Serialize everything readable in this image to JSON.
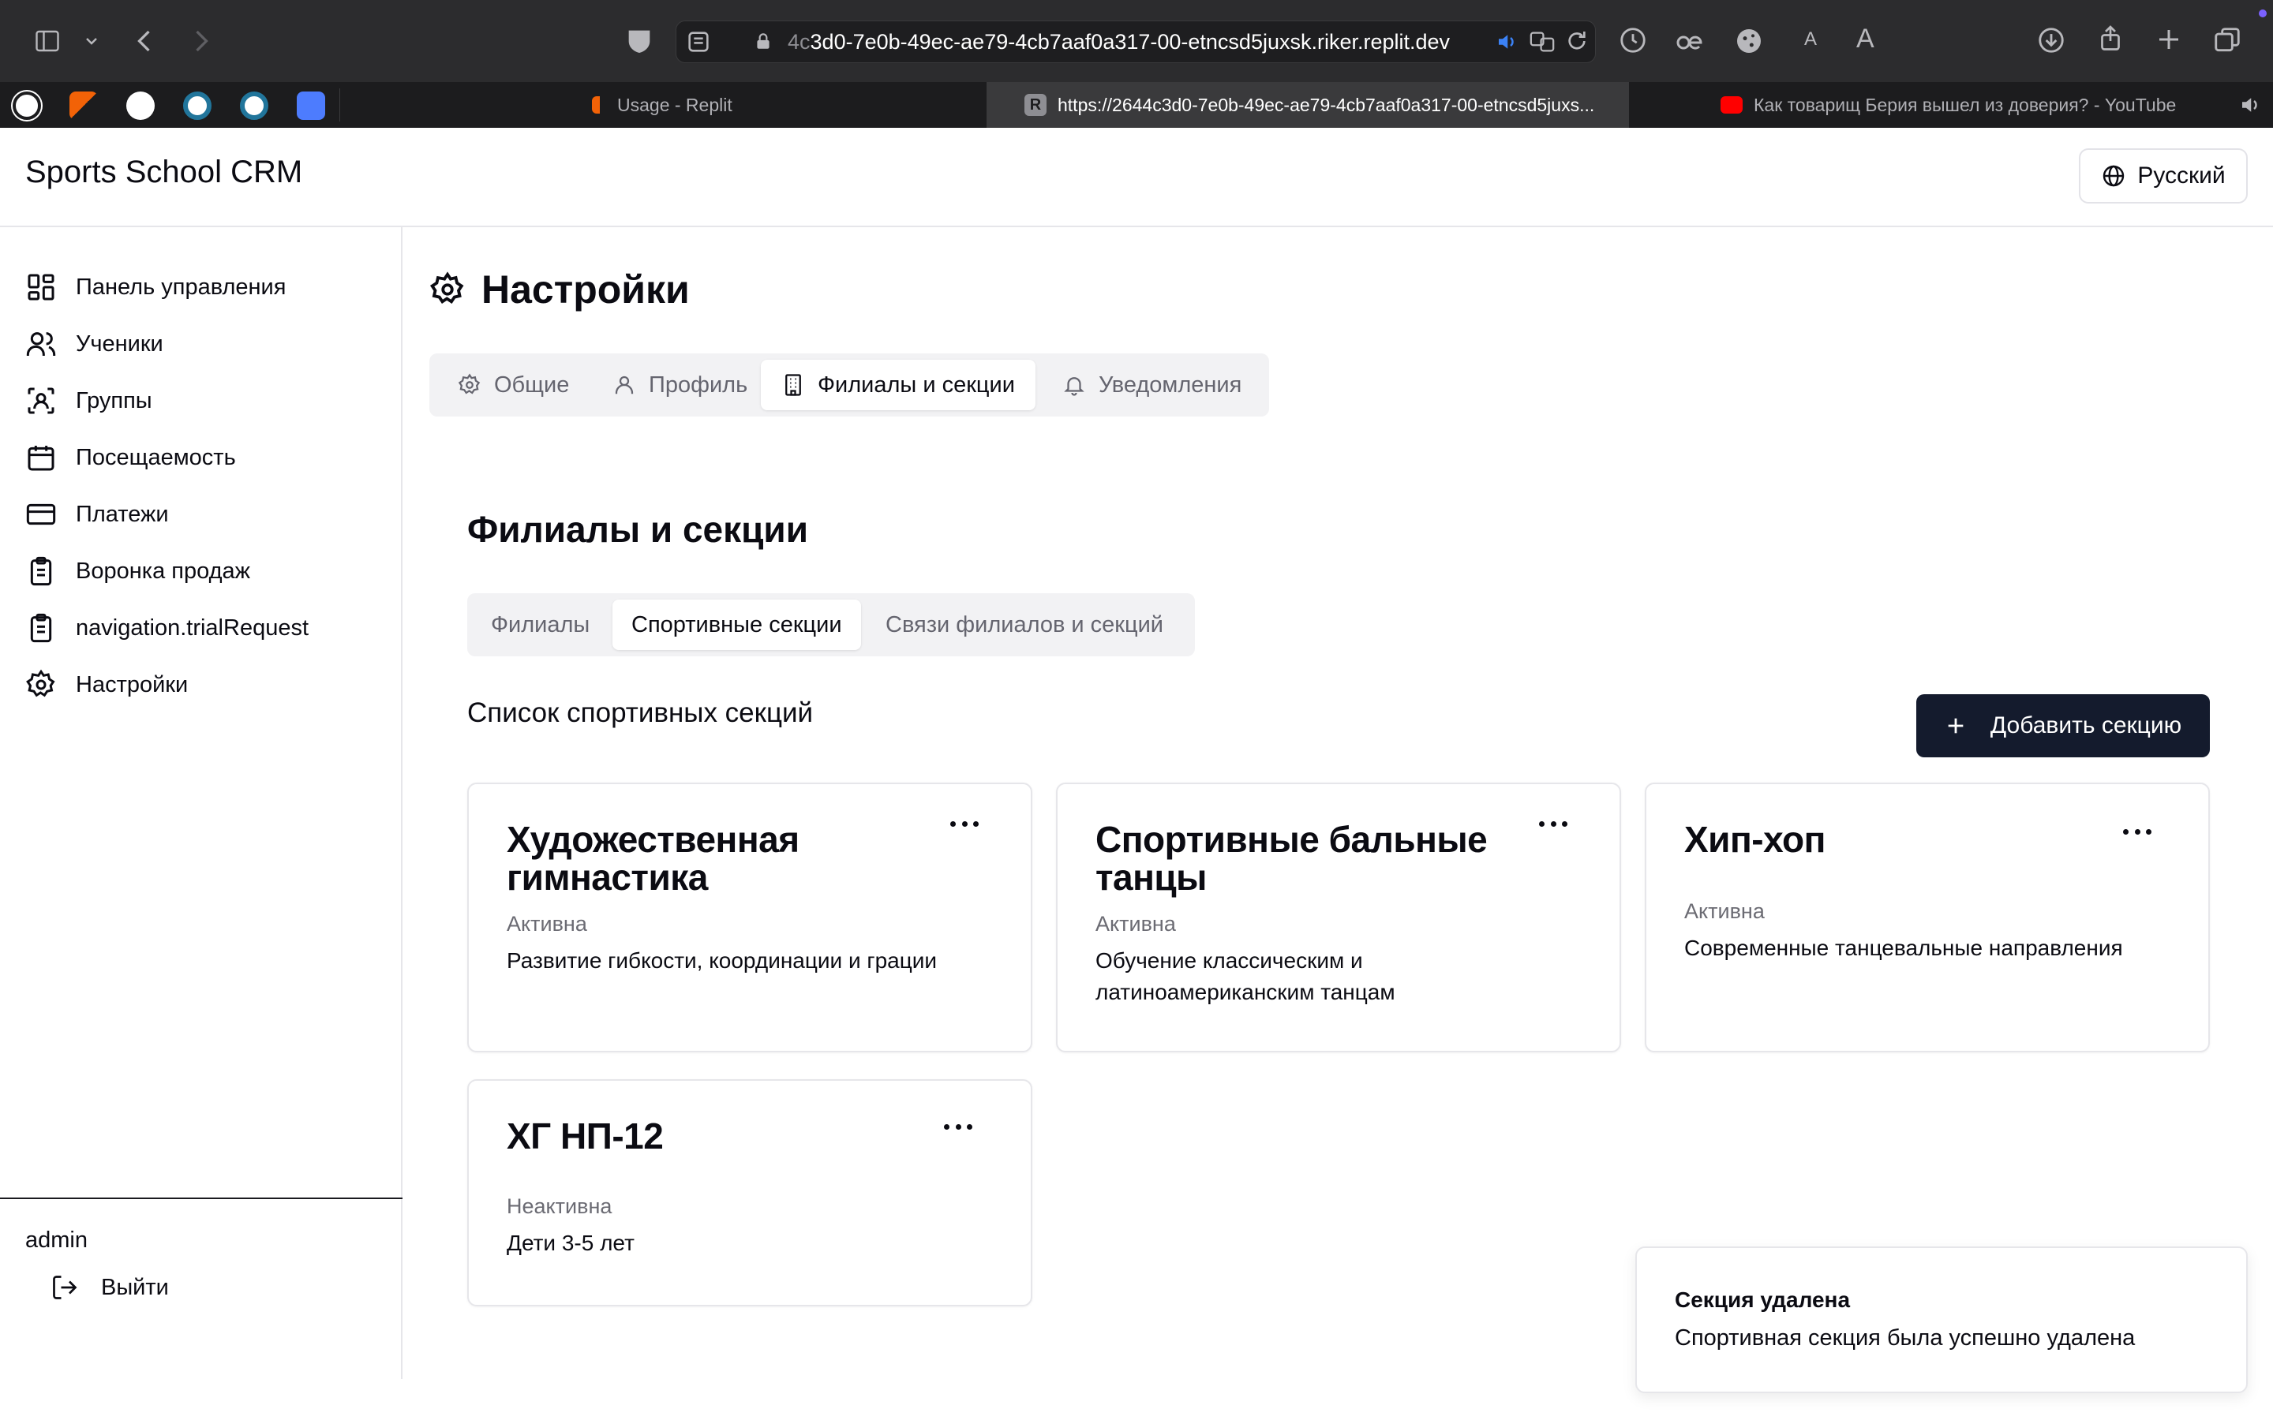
{
  "browser": {
    "url_dim": "4c",
    "url_main": "3d0-7e0b-49ec-ae79-4cb7aaf0a317-00-etncsd5juxsk.riker.replit.dev",
    "reader_a_small": "A",
    "reader_a_large": "A",
    "tabs": [
      {
        "label": "Usage - Replit",
        "favicon_color": "#f26207"
      },
      {
        "label": "https://2644c3d0-7e0b-49ec-ae79-4cb7aaf0a317-00-etncsd5juxs...",
        "favicon_letter": "R",
        "favicon_color": "#8e8e93"
      },
      {
        "label": "Как товарищ Берия вышел из доверия? - YouTube",
        "favicon_color": "#ff0000"
      }
    ]
  },
  "app": {
    "title": "Sports School CRM",
    "language_label": "Русский"
  },
  "sidebar": {
    "items": [
      {
        "label": "Панель управления",
        "icon": "dashboard-icon"
      },
      {
        "label": "Ученики",
        "icon": "users-icon"
      },
      {
        "label": "Группы",
        "icon": "groups-icon"
      },
      {
        "label": "Посещаемость",
        "icon": "calendar-icon"
      },
      {
        "label": "Платежи",
        "icon": "card-icon"
      },
      {
        "label": "Воронка продаж",
        "icon": "clipboard-icon"
      },
      {
        "label": "navigation.trialRequest",
        "icon": "clipboard-icon"
      },
      {
        "label": "Настройки",
        "icon": "gear-icon"
      }
    ],
    "user": "admin",
    "logout_label": "Выйти"
  },
  "page": {
    "heading": "Настройки",
    "settings_tabs": [
      {
        "label": "Общие",
        "icon": "gear-icon"
      },
      {
        "label": "Профиль",
        "icon": "user-icon"
      },
      {
        "label": "Филиалы и секции",
        "icon": "building-icon",
        "active": true
      },
      {
        "label": "Уведомления",
        "icon": "bell-icon"
      }
    ],
    "section_title": "Филиалы и секции",
    "sub_tabs": [
      {
        "label": "Филиалы"
      },
      {
        "label": "Спортивные секции",
        "active": true
      },
      {
        "label": "Связи филиалов и секций"
      }
    ],
    "list_title": "Список спортивных секций",
    "add_button": "Добавить секцию",
    "sections": [
      {
        "name": "Художественная гимнастика",
        "status": "Активна",
        "description": "Развитие гибкости, координации и грации"
      },
      {
        "name": "Спортивные бальные танцы",
        "status": "Активна",
        "description": "Обучение классическим и латиноамериканским танцам"
      },
      {
        "name": "Хип-хоп",
        "status": "Активна",
        "description": "Современные танцевальные направления"
      },
      {
        "name": "ХГ НП-12",
        "status": "Неактивна",
        "description": "Дети 3-5 лет"
      }
    ]
  },
  "toast": {
    "title": "Секция удалена",
    "message": "Спортивная секция была успешно удалена"
  },
  "colors": {
    "primary_button": "#141b2d",
    "muted_text": "#6b6b73",
    "tab_bg": "#f2f2f4"
  }
}
